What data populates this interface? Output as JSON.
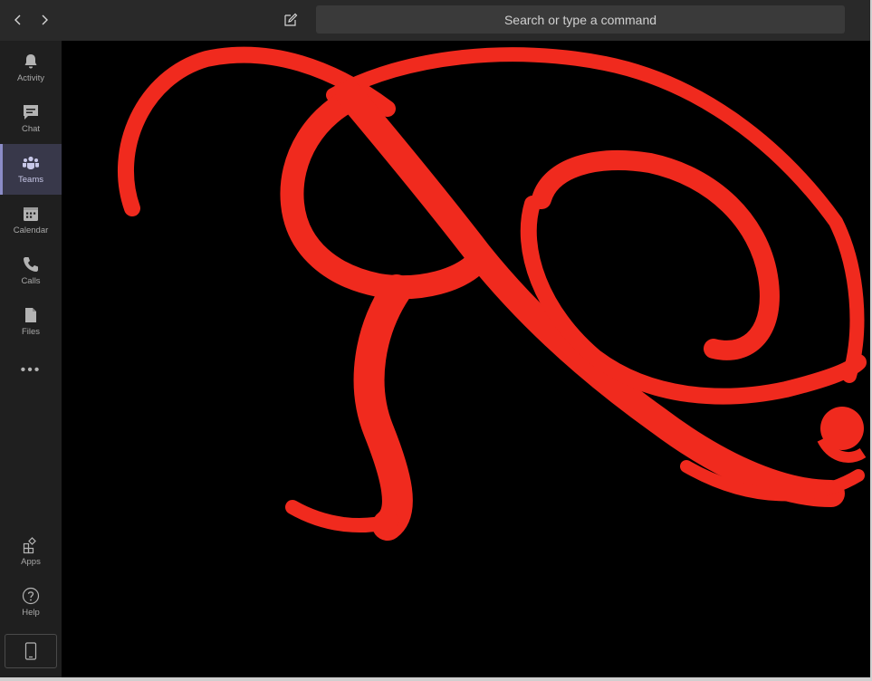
{
  "titlebar": {
    "back_icon": "chevron-left-icon",
    "forward_icon": "chevron-right-icon",
    "compose_icon": "compose-icon",
    "search_placeholder": "Search or type a command"
  },
  "rail": {
    "items": [
      {
        "label": "Activity",
        "icon": "bell-icon"
      },
      {
        "label": "Chat",
        "icon": "chat-icon"
      },
      {
        "label": "Teams",
        "icon": "teams-icon",
        "active": true
      },
      {
        "label": "Calendar",
        "icon": "calendar-icon"
      },
      {
        "label": "Calls",
        "icon": "phone-icon"
      },
      {
        "label": "Files",
        "icon": "file-icon"
      }
    ],
    "more_label": "•••",
    "bottom_items": [
      {
        "label": "Apps",
        "icon": "apps-icon"
      },
      {
        "label": "Help",
        "icon": "help-icon"
      }
    ],
    "device_icon": "mobile-device-icon"
  },
  "content": {
    "image_icon": "calligraphic-letter-image",
    "image_stroke_color": "#f02a1e",
    "background_color": "#000000"
  },
  "colors": {
    "titlebar": "#292929",
    "rail": "#1f1f1f",
    "active_rail": "#38384a",
    "accent": "#8b8cc7"
  }
}
